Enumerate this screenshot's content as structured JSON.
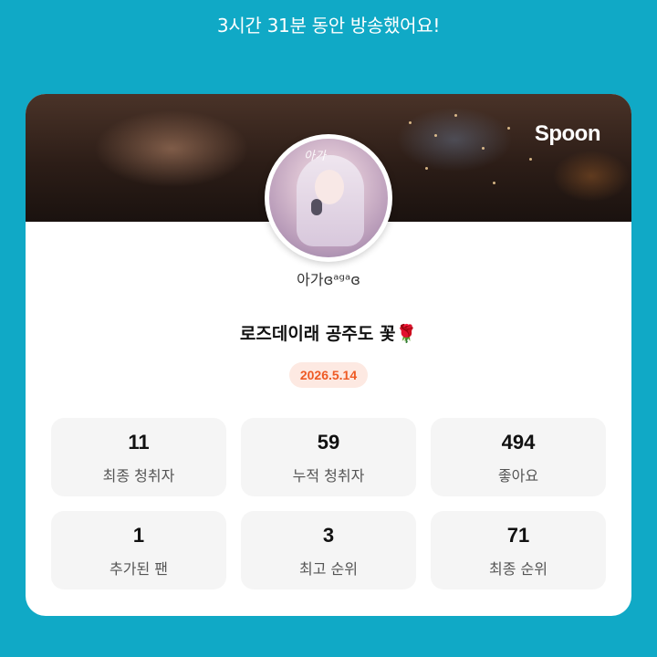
{
  "header": {
    "broadcast_summary": "3시간 31분 동안 방송했어요!"
  },
  "card": {
    "brand": "Spoon",
    "avatar_text": "아가",
    "nickname": "아가ɞᵃᵍᵃɞ",
    "cast_title": "로즈데이래 공주도 꽃🌹",
    "date": "2026.5.14",
    "accent_color": "#ee5a24",
    "background_color": "#10a9c6"
  },
  "stats": [
    {
      "value": "11",
      "label": "최종 청취자"
    },
    {
      "value": "59",
      "label": "누적 청취자"
    },
    {
      "value": "494",
      "label": "좋아요"
    },
    {
      "value": "1",
      "label": "추가된 팬"
    },
    {
      "value": "3",
      "label": "최고 순위"
    },
    {
      "value": "71",
      "label": "최종 순위"
    }
  ]
}
